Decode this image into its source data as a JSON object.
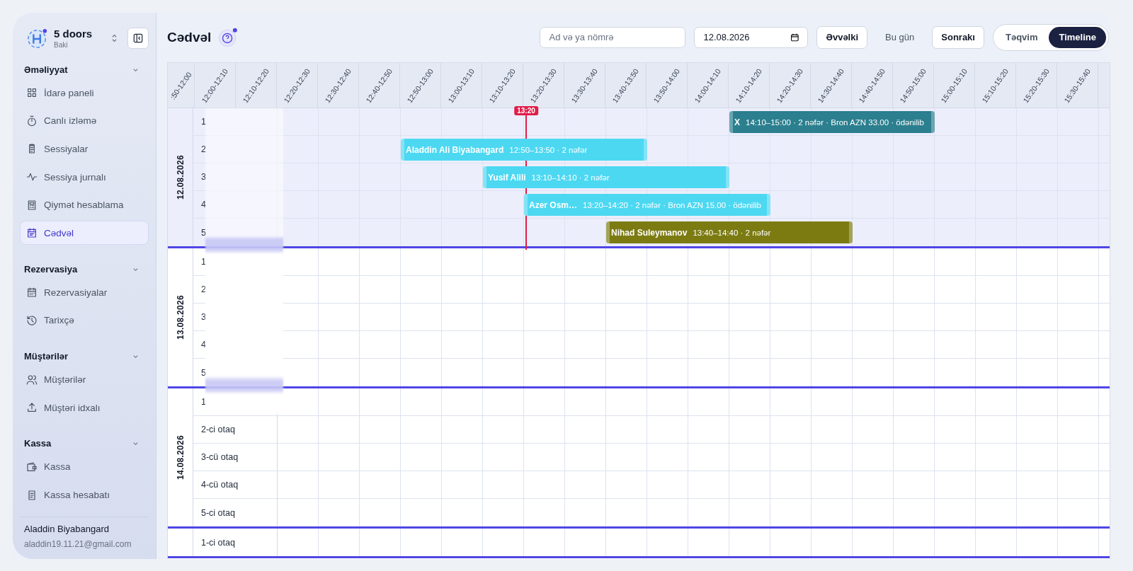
{
  "sidebar": {
    "brand": {
      "name": "5 doors",
      "location": "Baki"
    },
    "sections": [
      {
        "title": "Əməliyyat",
        "expanded": true,
        "items": [
          {
            "label": "İdarə paneli",
            "selected": false
          },
          {
            "label": "Canlı izləmə",
            "selected": false
          },
          {
            "label": "Sessiyalar",
            "selected": false
          },
          {
            "label": "Sessiya jurnalı",
            "selected": false
          },
          {
            "label": "Qiymət hesablama",
            "selected": false
          },
          {
            "label": "Cədvəl",
            "selected": true
          }
        ]
      },
      {
        "title": "Rezervasiya",
        "expanded": true,
        "items": [
          {
            "label": "Rezervasiyalar",
            "selected": false
          },
          {
            "label": "Tarixçə",
            "selected": false
          }
        ]
      },
      {
        "title": "Müştərilər",
        "expanded": true,
        "items": [
          {
            "label": "Müştərilər",
            "selected": false
          },
          {
            "label": "Müştəri idxalı",
            "selected": false
          }
        ]
      },
      {
        "title": "Kassa",
        "expanded": true,
        "items": [
          {
            "label": "Kassa",
            "selected": false
          },
          {
            "label": "Kassa hesabatı",
            "selected": false
          }
        ]
      }
    ],
    "user": {
      "name": "Aladdin Biyabangard",
      "email": "aladdin19.11.21@gmail.com"
    }
  },
  "header": {
    "title": "Cədvəl",
    "search": {
      "placeholder": "Ad və ya nömrə"
    },
    "date": "12.08.2026",
    "prev": "Əvvəlki",
    "today": "Bu gün",
    "next": "Sonrakı",
    "views": [
      {
        "label": "Təqvim",
        "selected": false
      },
      {
        "label": "Timeline",
        "selected": true
      }
    ]
  },
  "timeline": {
    "time_slots": [
      ":50-12:00",
      "12:00-12:10",
      "12:10-12:20",
      "12:20-12:30",
      "12:30-12:40",
      "12:40-12:50",
      "12:50-13:00",
      "13:00-13:10",
      "13:10-13:20",
      "13:20-13:30",
      "13:30-13:40",
      "13:40-13:50",
      "13:50-14:00",
      "14:00-14:10",
      "14:10-14:20",
      "14:20-14:30",
      "14:30-14:40",
      "14:40-14:50",
      "14:50-15:00",
      "15:00-15:10",
      "15:10-15:20",
      "15:20-15:30",
      "15:30-15:40"
    ],
    "now_marker": {
      "label": "13:20"
    },
    "days": [
      {
        "date": "12.08.2026",
        "current": true,
        "rooms": [
          {
            "label": "1",
            "events": [
              {
                "name": "X",
                "details": "14:10–15:00 · 2 nəfər · Bron AZN 33.00 · ödənilib",
                "color": "#2b7f8e"
              }
            ]
          },
          {
            "label": "2",
            "events": [
              {
                "name": "Aladdin Ali Biyabangard",
                "details": "12:50–13:50 · 2 nəfər",
                "color": "#4dd8f2"
              }
            ]
          },
          {
            "label": "3",
            "events": [
              {
                "name": "Yusif Alili",
                "details": "13:10–14:10 · 2 nəfər",
                "color": "#4dd8f2"
              }
            ]
          },
          {
            "label": "4",
            "events": [
              {
                "name": "Azer Osm…",
                "details": "13:20–14:20 · 2 nəfər · Bron AZN 15.00 · ödənilib",
                "color": "#4dd8f2"
              }
            ]
          },
          {
            "label": "5",
            "events": [
              {
                "name": "Nihad Suleymanov",
                "details": "13:40–14:40 · 2 nəfər",
                "color": "#7c7b12"
              }
            ]
          }
        ]
      },
      {
        "date": "13.08.2026",
        "current": false,
        "rooms": [
          {
            "label": "1"
          },
          {
            "label": "2"
          },
          {
            "label": "3"
          },
          {
            "label": "4"
          },
          {
            "label": "5"
          }
        ]
      },
      {
        "date": "14.08.2026",
        "current": false,
        "rooms": [
          {
            "label": "1"
          },
          {
            "label": "2-ci otaq"
          },
          {
            "label": "3-cü otaq"
          },
          {
            "label": "4-cü otaq"
          },
          {
            "label": "5-ci otaq"
          }
        ]
      },
      {
        "current": false,
        "rooms": [
          {
            "label": "1-ci otaq"
          }
        ]
      }
    ]
  }
}
